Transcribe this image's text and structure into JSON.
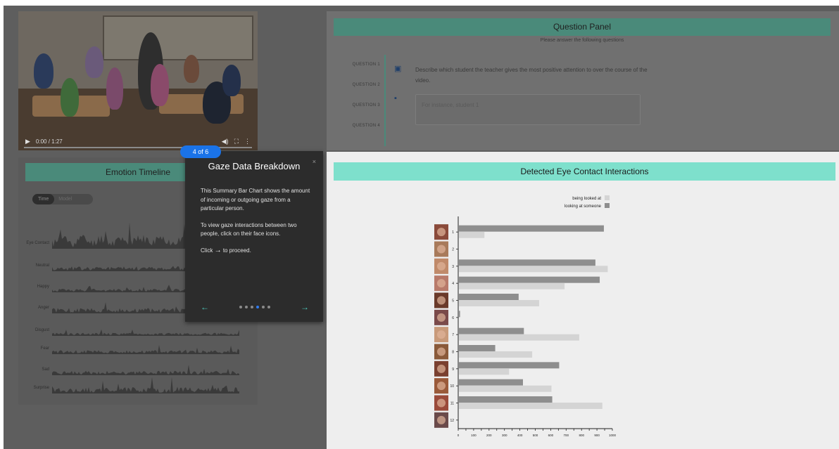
{
  "video": {
    "time": "0:00 / 1:27",
    "play_icon": "play-icon",
    "volume_icon": "volume-icon",
    "fullscreen_icon": "fullscreen-icon",
    "more_icon": "more-options-icon"
  },
  "question_panel": {
    "title": "Question Panel",
    "subtitle": "Please answer the following questions",
    "nav": [
      "QUESTION 1",
      "QUESTION 2",
      "QUESTION 3",
      "QUESTION 4"
    ],
    "question_text": "Describe which student the teacher gives the most positive attention to over the course of the video.",
    "answer_placeholder": "For instance, student 1"
  },
  "emotion_timeline": {
    "title": "Emotion Timeline",
    "toggle_on": "Time",
    "toggle_off": "Model",
    "rows": [
      "Eye Contact",
      "Neutral",
      "Happy",
      "Anger",
      "Disgust",
      "Fear",
      "Sad",
      "Surprise"
    ]
  },
  "tutorial": {
    "badge": "4 of 6",
    "title": "Gaze Data Breakdown",
    "close": "×",
    "para1": "This Summary Bar Chart shows the amount of incoming or outgoing gaze from a particular person.",
    "para2": "To view gaze interactions between two people, click on their face icons.",
    "click_prefix": "Click",
    "click_arrow": "→",
    "click_suffix": "to proceed.",
    "prev_arrow": "←",
    "next_arrow": "→",
    "dots": 6,
    "active_dot": 4
  },
  "eye_contact_panel": {
    "title": "Detected Eye Contact Interactions"
  },
  "chart_data": {
    "type": "bar",
    "orientation": "horizontal",
    "categories": [
      "1",
      "2",
      "3",
      "4",
      "5",
      "6",
      "7",
      "8",
      "9",
      "10",
      "11",
      "12"
    ],
    "series": [
      {
        "name": "looking at someone",
        "color": "#8e8e8e",
        "values": [
          945,
          0,
          890,
          918,
          392,
          12,
          426,
          240,
          655,
          420,
          610,
          0
        ]
      },
      {
        "name": "being looked at",
        "color": "#d4d4d4",
        "values": [
          170,
          0,
          970,
          690,
          525,
          0,
          785,
          480,
          330,
          605,
          935,
          0
        ]
      }
    ],
    "xlim": [
      0,
      1000
    ],
    "x_ticks": [
      "0",
      "50",
      "100",
      "150",
      "200",
      "250",
      "300",
      "350",
      "400",
      "450",
      "500",
      "550",
      "600",
      "650",
      "700",
      "750",
      "800",
      "850",
      "900",
      "950",
      "1000"
    ],
    "legend_position": "top-right",
    "grid": false
  },
  "colors": {
    "accent_teal": "#7ee0cc",
    "badge_blue": "#1a73e8",
    "overlay_dark": "#2c2c2c"
  }
}
